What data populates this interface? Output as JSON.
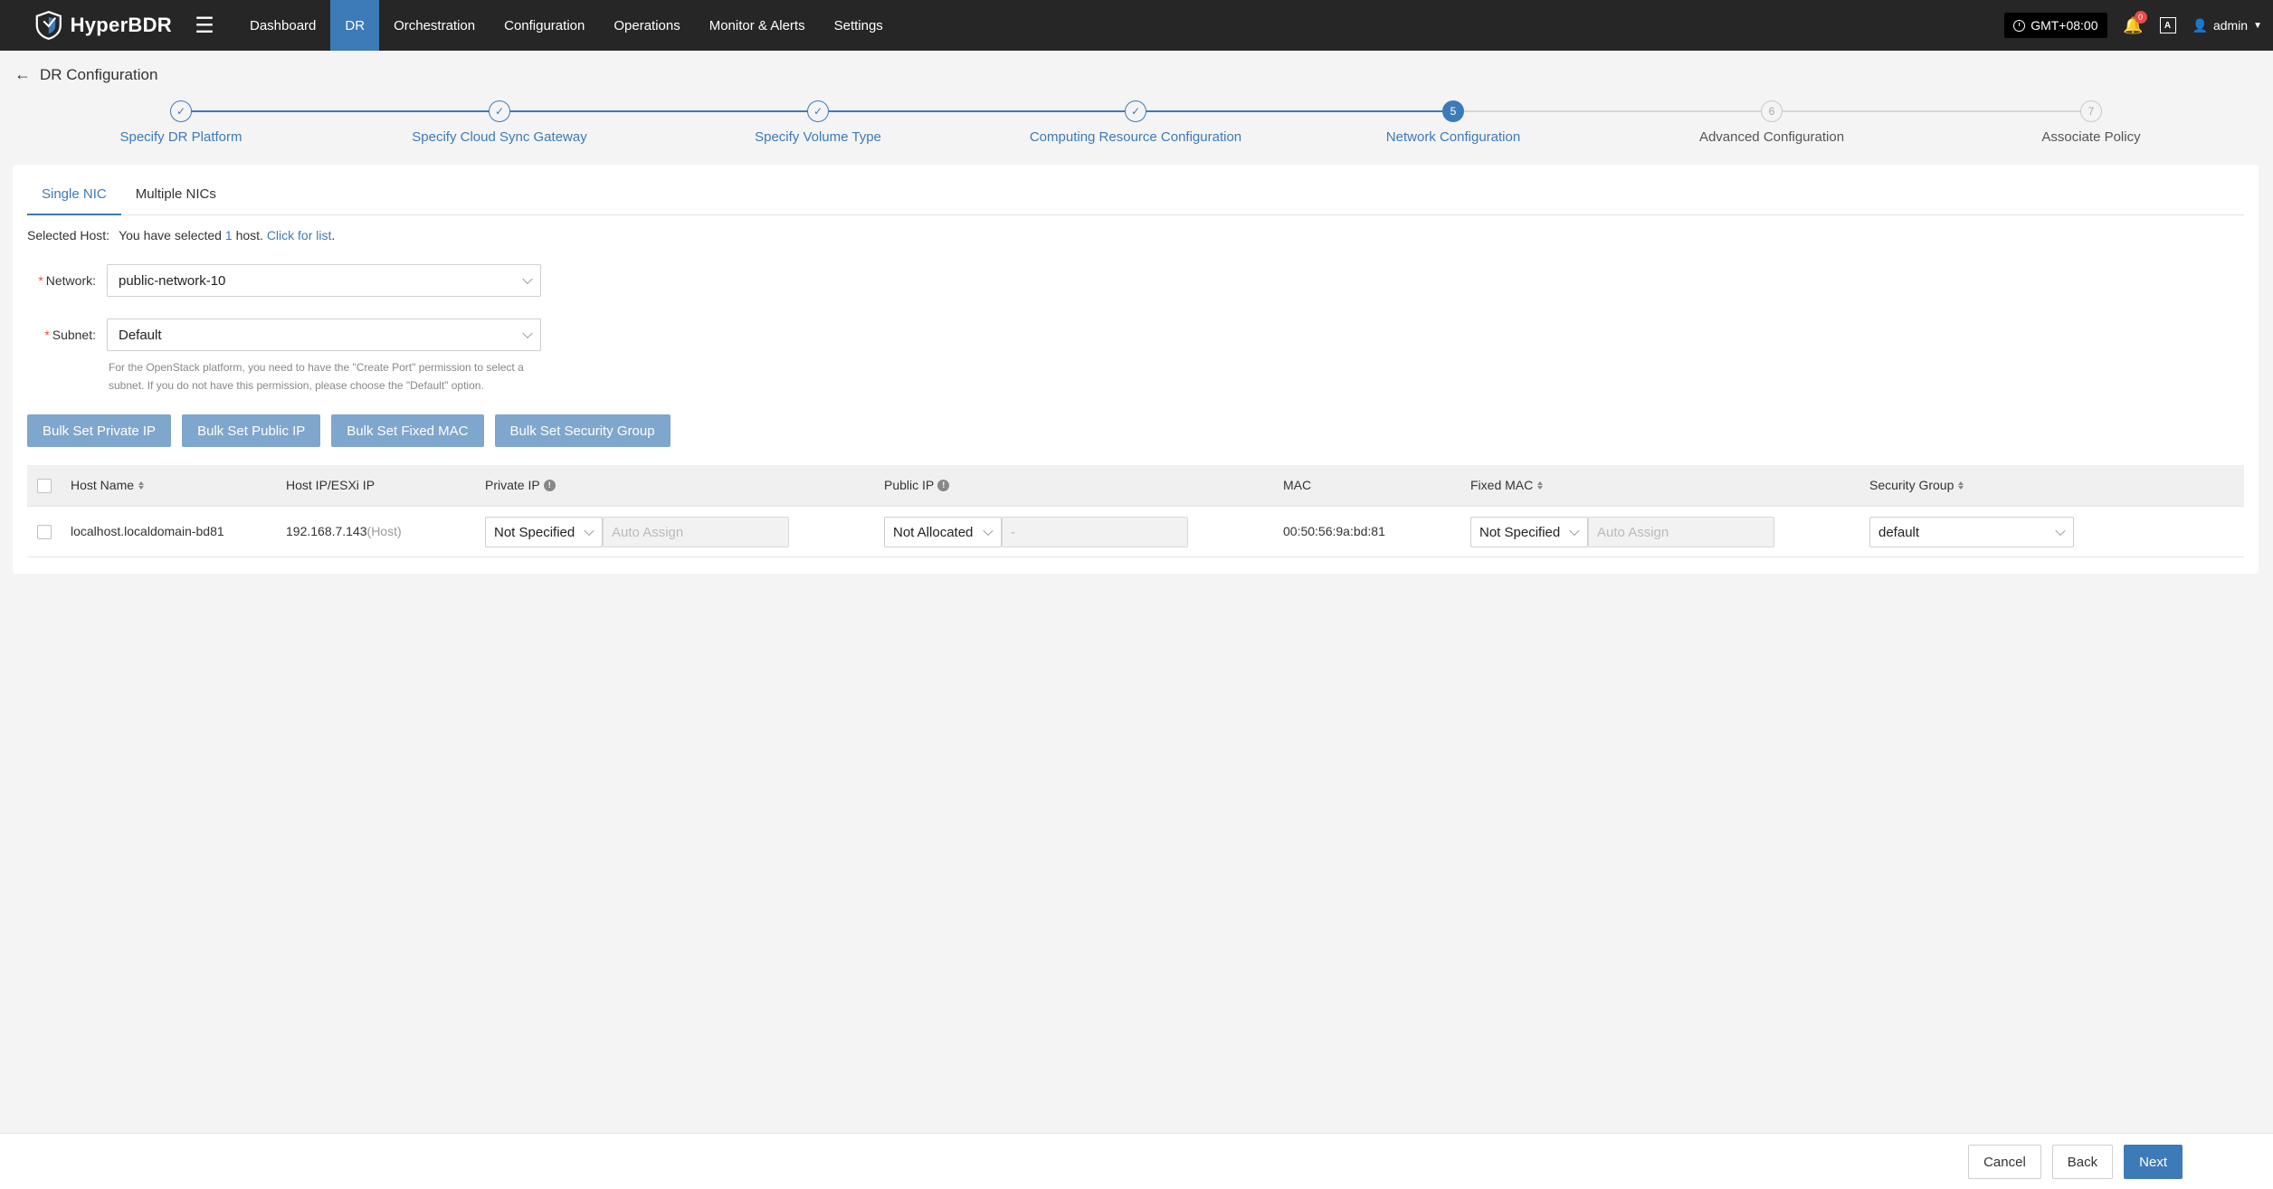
{
  "app": {
    "name": "HyperBDR"
  },
  "nav": {
    "items": [
      {
        "label": "Dashboard",
        "active": false
      },
      {
        "label": "DR",
        "active": true
      },
      {
        "label": "Orchestration",
        "active": false
      },
      {
        "label": "Configuration",
        "active": false
      },
      {
        "label": "Operations",
        "active": false
      },
      {
        "label": "Monitor & Alerts",
        "active": false
      },
      {
        "label": "Settings",
        "active": false
      }
    ]
  },
  "topright": {
    "timezone": "GMT+08:00",
    "notification_count": "0",
    "lang_glyph": "A",
    "user": "admin"
  },
  "page": {
    "title": "DR Configuration"
  },
  "steps": [
    {
      "label": "Specify DR Platform",
      "state": "done",
      "num": "1"
    },
    {
      "label": "Specify Cloud Sync Gateway",
      "state": "done",
      "num": "2"
    },
    {
      "label": "Specify Volume Type",
      "state": "done",
      "num": "3"
    },
    {
      "label": "Computing Resource Configuration",
      "state": "done",
      "num": "4"
    },
    {
      "label": "Network Configuration",
      "state": "current",
      "num": "5"
    },
    {
      "label": "Advanced Configuration",
      "state": "todo",
      "num": "6"
    },
    {
      "label": "Associate Policy",
      "state": "todo",
      "num": "7"
    }
  ],
  "tabs": [
    {
      "label": "Single NIC",
      "active": true
    },
    {
      "label": "Multiple NICs",
      "active": false
    }
  ],
  "selected_host": {
    "label": "Selected Host:",
    "prefix": "You have selected",
    "count": "1",
    "suffix": "host.",
    "link": "Click for list",
    "end": "."
  },
  "form": {
    "network_label": "Network:",
    "network_value": "public-network-10",
    "subnet_label": "Subnet:",
    "subnet_value": "Default",
    "help_line1": "For the OpenStack platform, you need to have the \"Create Port\" permission to select a",
    "help_line2": "subnet. If you do not have this permission, please choose the \"Default\" option."
  },
  "bulk_buttons": {
    "private_ip": "Bulk Set Private IP",
    "public_ip": "Bulk Set Public IP",
    "fixed_mac": "Bulk Set Fixed MAC",
    "security_group": "Bulk Set Security Group"
  },
  "table": {
    "headers": {
      "host_name": "Host Name",
      "host_ip": "Host IP/ESXi IP",
      "private_ip": "Private IP",
      "public_ip": "Public IP",
      "mac": "MAC",
      "fixed_mac": "Fixed MAC",
      "security_group": "Security Group"
    },
    "rows": [
      {
        "host_name": "localhost.localdomain-bd81",
        "host_ip": "192.168.7.143",
        "host_ip_tag": "(Host)",
        "private_ip_mode": "Not Specified",
        "private_ip_placeholder": "Auto Assign",
        "public_ip_mode": "Not Allocated",
        "public_ip_placeholder": "-",
        "mac": "00:50:56:9a:bd:81",
        "fixed_mac_mode": "Not Specified",
        "fixed_mac_placeholder": "Auto Assign",
        "security_group": "default"
      }
    ]
  },
  "footer": {
    "cancel": "Cancel",
    "back": "Back",
    "next": "Next"
  },
  "colors": {
    "accent": "#3d7ab8",
    "topbar": "#262626",
    "bulk_button": "#7fa6cc"
  }
}
